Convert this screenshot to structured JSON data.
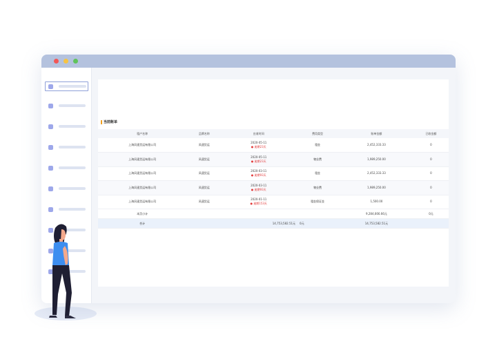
{
  "window": {
    "dots": [
      "red-dot",
      "yellow-dot",
      "green-dot"
    ]
  },
  "sidebar": {
    "items": [
      {
        "id": "1",
        "active": true
      },
      {
        "id": "2"
      },
      {
        "id": "3"
      },
      {
        "id": "4"
      },
      {
        "id": "5"
      },
      {
        "id": "6"
      },
      {
        "id": "7"
      },
      {
        "id": "8"
      },
      {
        "id": "9"
      },
      {
        "id": "10"
      }
    ]
  },
  "section": {
    "title": "当前账单"
  },
  "table": {
    "headers": [
      "租户名称",
      "品牌名称",
      "应收时间",
      "费用类型",
      "账单金额",
      "已收金额"
    ],
    "rows": [
      {
        "tenant": "上海风速货运有限公司",
        "brand": "风速货运",
        "date": "2020-05-11",
        "overdue": "● 逾期23天",
        "type": "租金",
        "amount": "2,452,333.33",
        "received": "0"
      },
      {
        "tenant": "上海风速货运有限公司",
        "brand": "风速货运",
        "date": "2020-05-11",
        "overdue": "● 逾期23天",
        "type": "物业费",
        "amount": "1,989,250.00",
        "received": "0"
      },
      {
        "tenant": "上海风速货运有限公司",
        "brand": "风速货运",
        "date": "2020-03-11",
        "overdue": "● 逾期93天",
        "type": "租金",
        "amount": "2,452,333.33",
        "received": "0"
      },
      {
        "tenant": "上海风速货运有限公司",
        "brand": "风速货运",
        "date": "2020-03-11",
        "overdue": "● 逾期93天",
        "type": "物业费",
        "amount": "1,989,250.00",
        "received": "0"
      },
      {
        "tenant": "上海风速货运有限公司",
        "brand": "风速货运",
        "date": "2020-01-11",
        "overdue": "● 逾期153天",
        "type": "租金保证金",
        "amount": "1,500.00",
        "received": "0"
      }
    ],
    "subtotal": {
      "label": "本页小计",
      "amount": "9,284,666.66元",
      "received": "0元"
    },
    "total": {
      "label": "合计",
      "amount1": "14,753,582.51元",
      "zero": "0元",
      "amount2": "14,753,582.51元"
    }
  },
  "colors": {
    "titlebar": "#b4c2de",
    "accent": "#9ea8ea",
    "overdue": "#e23b3b",
    "person_top": "#3d8ef0",
    "person_legs": "#1f1f33"
  }
}
